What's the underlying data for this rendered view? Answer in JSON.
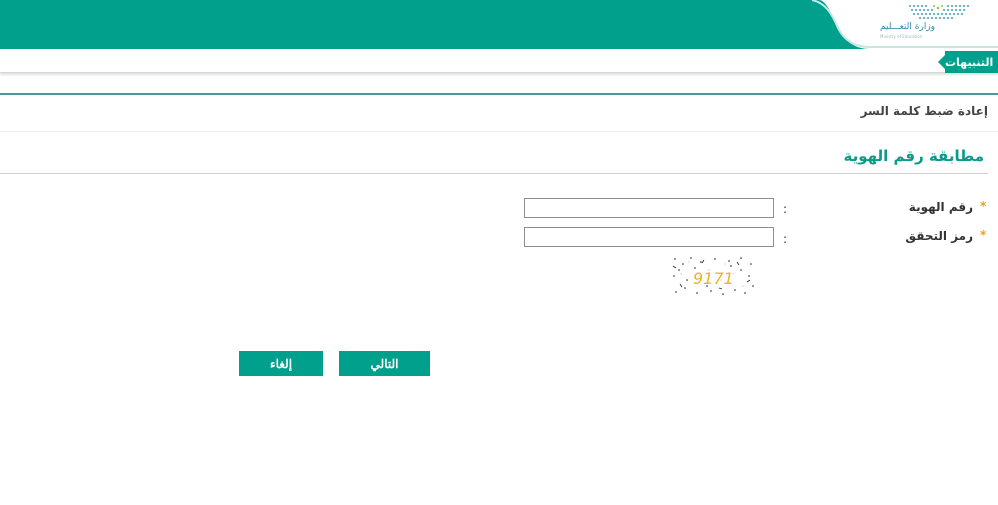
{
  "header": {
    "ministry_name": "وزارة التعـــليم",
    "ministry_sub": "Ministry of Education"
  },
  "alerts_tab": {
    "label": "التنبيهات"
  },
  "page": {
    "heading": "إعادة ضبط كلمة السر"
  },
  "section": {
    "title": "مطابقة رقم الهوية"
  },
  "form": {
    "id_number": {
      "required_mark": "*",
      "label": "رقم الهوية",
      "colon": ":",
      "value": ""
    },
    "verification_code": {
      "required_mark": "*",
      "label": "رمز التحقق",
      "colon": ":",
      "value": ""
    },
    "captcha_text": "9171"
  },
  "buttons": {
    "next_label": "التالي",
    "cancel_label": "إلغاء"
  },
  "colors": {
    "brand_teal": "#00a08c",
    "required_star": "#e8a31e"
  }
}
